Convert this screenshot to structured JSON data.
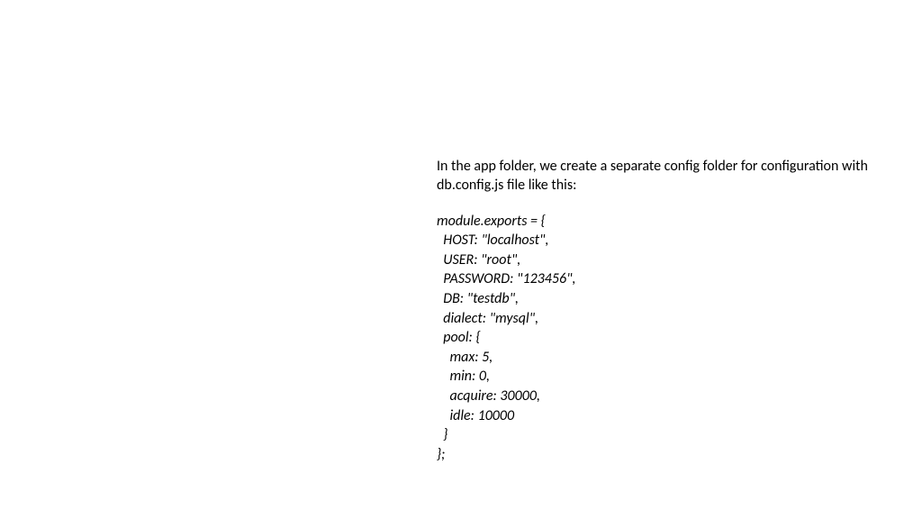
{
  "intro": "In the app folder, we create a separate config folder for configuration with db.config.js file like this:",
  "code": "module.exports = {\n  HOST: \"localhost\",\n  USER: \"root\",\n  PASSWORD: \"123456\",\n  DB: \"testdb\",\n  dialect: \"mysql\",\n  pool: {\n    max: 5,\n    min: 0,\n    acquire: 30000,\n    idle: 10000\n  }\n};"
}
